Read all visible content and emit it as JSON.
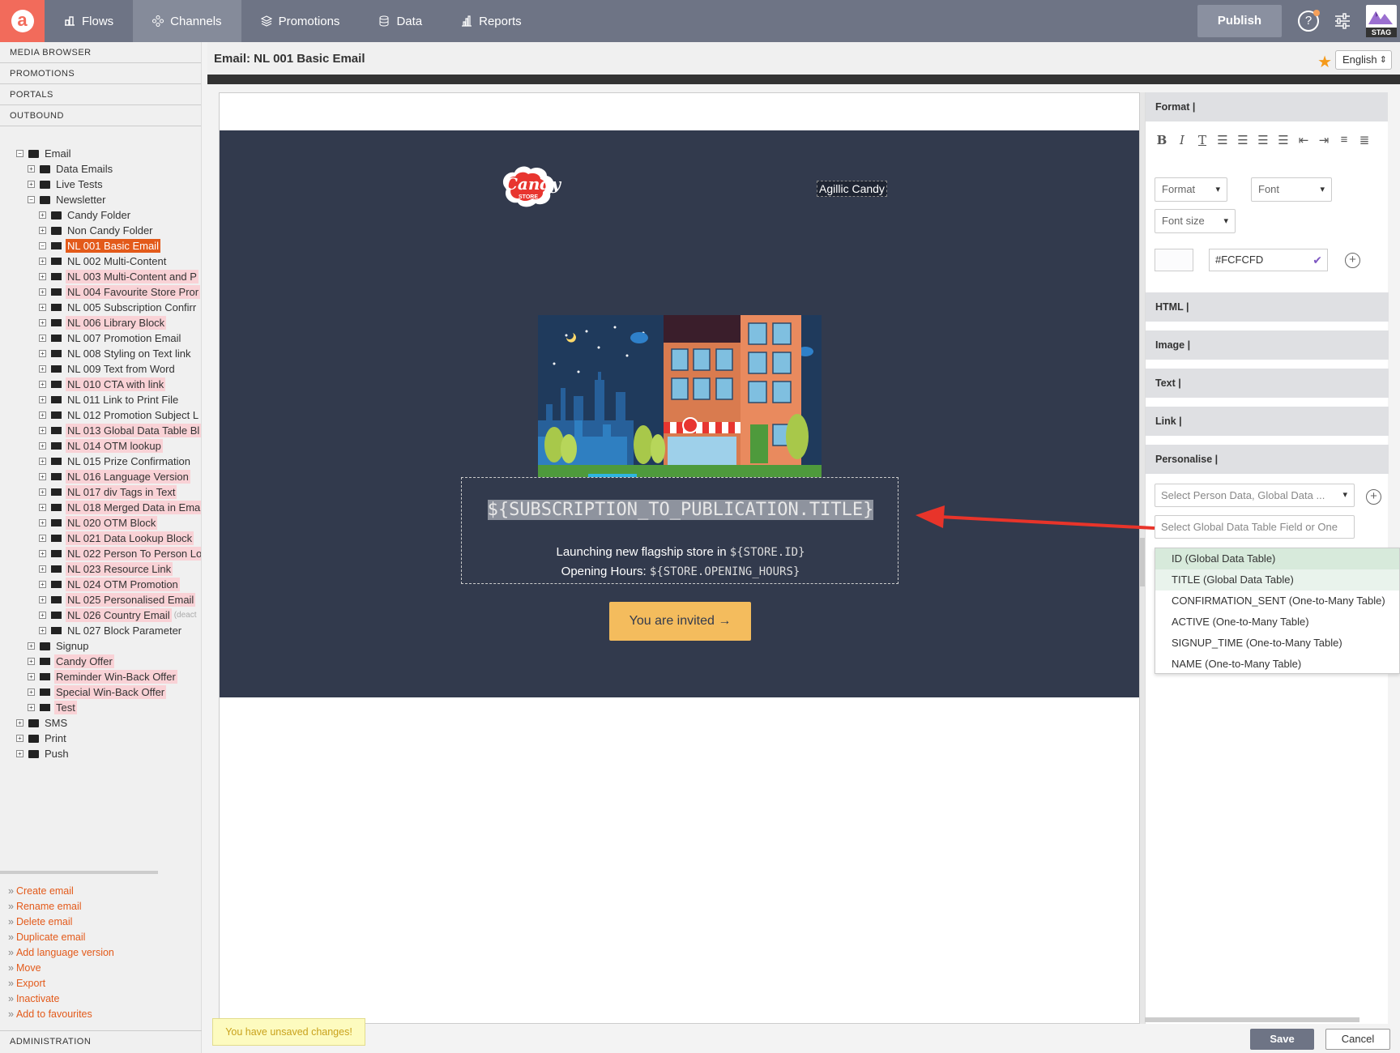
{
  "nav": {
    "logo_letter": "a",
    "tabs": [
      {
        "label": "Flows",
        "icon": "flows-icon"
      },
      {
        "label": "Channels",
        "icon": "channels-icon"
      },
      {
        "label": "Promotions",
        "icon": "promotions-icon"
      },
      {
        "label": "Data",
        "icon": "database-icon"
      },
      {
        "label": "Reports",
        "icon": "reports-icon"
      }
    ],
    "active_tab": "Channels",
    "publish_label": "Publish",
    "help_symbol": "?",
    "env_badge": "STAG"
  },
  "sidebar": {
    "sections": [
      "MEDIA BROWSER",
      "PROMOTIONS",
      "PORTALS",
      "OUTBOUND"
    ],
    "tree": [
      {
        "label": "Email",
        "level": 0,
        "exp": "⊟",
        "type": "folder"
      },
      {
        "label": "Data Emails",
        "level": 1,
        "exp": "⊞",
        "type": "folder"
      },
      {
        "label": "Live Tests",
        "level": 1,
        "exp": "⊞",
        "type": "folder"
      },
      {
        "label": "Newsletter",
        "level": 1,
        "exp": "⊟",
        "type": "folder"
      },
      {
        "label": "Candy Folder",
        "level": 2,
        "exp": "⊞",
        "type": "folder"
      },
      {
        "label": "Non Candy Folder",
        "level": 2,
        "exp": "⊞",
        "type": "folder"
      },
      {
        "label": "NL 001 Basic Email",
        "level": 2,
        "exp": "⊟",
        "type": "email",
        "style": "sel"
      },
      {
        "label": "NL 002 Multi-Content",
        "level": 2,
        "exp": "⊞",
        "type": "email"
      },
      {
        "label": "NL 003 Multi-Content and P",
        "level": 2,
        "exp": "⊞",
        "type": "email",
        "style": "pink"
      },
      {
        "label": "NL 004 Favourite Store Pror",
        "level": 2,
        "exp": "⊞",
        "type": "email",
        "style": "pink"
      },
      {
        "label": "NL 005 Subscription Confirr",
        "level": 2,
        "exp": "⊞",
        "type": "email"
      },
      {
        "label": "NL 006 Library Block",
        "level": 2,
        "exp": "⊞",
        "type": "email",
        "style": "pink"
      },
      {
        "label": "NL 007 Promotion Email",
        "level": 2,
        "exp": "⊞",
        "type": "email"
      },
      {
        "label": "NL 008 Styling on Text link",
        "level": 2,
        "exp": "⊞",
        "type": "email"
      },
      {
        "label": "NL 009 Text from Word",
        "level": 2,
        "exp": "⊞",
        "type": "email"
      },
      {
        "label": "NL 010 CTA with link",
        "level": 2,
        "exp": "⊞",
        "type": "email",
        "style": "pink"
      },
      {
        "label": "NL 011 Link to Print File",
        "level": 2,
        "exp": "⊞",
        "type": "email"
      },
      {
        "label": "NL 012 Promotion Subject L",
        "level": 2,
        "exp": "⊞",
        "type": "email"
      },
      {
        "label": "NL 013 Global Data Table Bl",
        "level": 2,
        "exp": "⊞",
        "type": "email",
        "style": "pink"
      },
      {
        "label": "NL 014 OTM lookup",
        "level": 2,
        "exp": "⊞",
        "type": "email",
        "style": "pink"
      },
      {
        "label": "NL 015 Prize Confirmation",
        "level": 2,
        "exp": "⊞",
        "type": "email"
      },
      {
        "label": "NL 016 Language Version",
        "level": 2,
        "exp": "⊞",
        "type": "email",
        "style": "pink"
      },
      {
        "label": "NL 017 div Tags in Text",
        "level": 2,
        "exp": "⊞",
        "type": "email",
        "style": "pink"
      },
      {
        "label": "NL 018 Merged Data in Ema",
        "level": 2,
        "exp": "⊞",
        "type": "email",
        "style": "pink"
      },
      {
        "label": "NL 020 OTM Block",
        "level": 2,
        "exp": "⊞",
        "type": "email",
        "style": "pink"
      },
      {
        "label": "NL 021 Data Lookup Block",
        "level": 2,
        "exp": "⊞",
        "type": "email",
        "style": "pink"
      },
      {
        "label": "NL 022 Person To Person Lo",
        "level": 2,
        "exp": "⊞",
        "type": "email",
        "style": "pink"
      },
      {
        "label": "NL 023 Resource Link",
        "level": 2,
        "exp": "⊞",
        "type": "email",
        "style": "pink"
      },
      {
        "label": "NL 024 OTM Promotion",
        "level": 2,
        "exp": "⊞",
        "type": "email",
        "style": "pink"
      },
      {
        "label": "NL 025 Personalised Email",
        "level": 2,
        "exp": "⊞",
        "type": "email",
        "style": "pink"
      },
      {
        "label": "NL 026 Country Email",
        "level": 2,
        "exp": "⊞",
        "type": "email",
        "style": "pink",
        "note": "(deact"
      },
      {
        "label": "NL 027 Block Parameter",
        "level": 2,
        "exp": "⊞",
        "type": "email"
      },
      {
        "label": "Signup",
        "level": 1,
        "exp": "⊞",
        "type": "folder"
      },
      {
        "label": "Candy Offer",
        "level": 1,
        "exp": "⊞",
        "type": "email",
        "style": "pink"
      },
      {
        "label": "Reminder Win-Back Offer",
        "level": 1,
        "exp": "⊞",
        "type": "email",
        "style": "pink"
      },
      {
        "label": "Special Win-Back Offer",
        "level": 1,
        "exp": "⊞",
        "type": "email",
        "style": "pink"
      },
      {
        "label": "Test",
        "level": 1,
        "exp": "⊞",
        "type": "email",
        "style": "pink"
      },
      {
        "label": "SMS",
        "level": 0,
        "exp": "⊞",
        "type": "folder"
      },
      {
        "label": "Print",
        "level": 0,
        "exp": "⊞",
        "type": "folder"
      },
      {
        "label": "Push",
        "level": 0,
        "exp": "⊞",
        "type": "folder"
      }
    ],
    "actions": [
      "Create email",
      "Rename email",
      "Delete email",
      "Duplicate email",
      "Add language version",
      "Move",
      "Export",
      "Inactivate",
      "Add to favourites"
    ],
    "admin_label": "ADMINISTRATION"
  },
  "content": {
    "title": "Email: NL 001 Basic Email",
    "language": "English"
  },
  "email": {
    "logo_text": "Candy",
    "logo_sub": "STORE",
    "brand_name": "Agillic Candy",
    "title_var": "${SUBSCRIPTION_TO_PUBLICATION.TITLE}",
    "launch_text": "Launching new flagship store in ",
    "launch_var": "${STORE.ID}",
    "hours_text": "Opening Hours: ",
    "hours_var": "${STORE.OPENING_HOURS}",
    "cta_label": "You are invited →"
  },
  "panel": {
    "format_head": "Format |",
    "format_select": "Format",
    "font_select": "Font",
    "font_size_select": "Font size",
    "color_value": "#FCFCFD",
    "sections": [
      "HTML |",
      "Image |",
      "Text |",
      "Link |",
      "Personalise |"
    ],
    "person_data_placeholder": "Select Person Data, Global Data ...",
    "gdt_placeholder": "Select Global Data Table Field or One",
    "dropdown_items": [
      "ID (Global Data Table)",
      "TITLE (Global Data Table)",
      "CONFIRMATION_SENT (One-to-Many Table)",
      "ACTIVE (One-to-Many Table)",
      "SIGNUP_TIME (One-to-Many Table)",
      "NAME (One-to-Many Table)"
    ]
  },
  "footer": {
    "unsaved": "You have unsaved changes!",
    "save": "Save",
    "cancel": "Cancel"
  },
  "colors": {
    "accent": "#e35a1a",
    "nav_bg": "#6e7485",
    "email_bg": "#323a4d",
    "cta": "#f4bc5d",
    "arrow": "#e8342a"
  }
}
